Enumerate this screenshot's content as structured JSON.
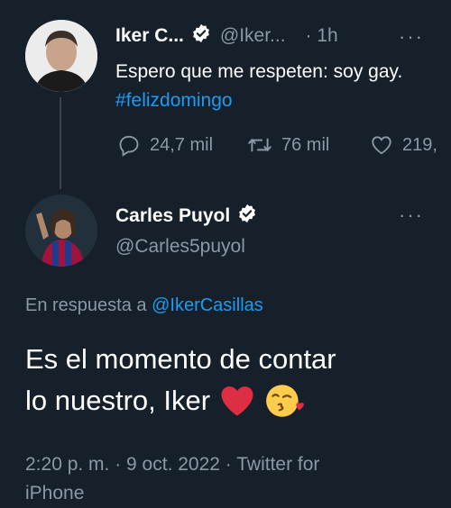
{
  "tweet1": {
    "name": "Iker C...",
    "handle": "@Iker...",
    "time": "· 1h",
    "text": "Espero que me respeten: soy gay. ",
    "hashtag": "#felizdomingo",
    "replies": "24,7 mil",
    "retweets": "76 mil",
    "likes": "219,"
  },
  "tweet2": {
    "name": "Carles Puyol",
    "handle": "@Carles5puyol",
    "reply_prefix": "En respuesta a ",
    "reply_handle": "@IkerCasillas",
    "text_line1": "Es el momento de contar",
    "text_line2": "lo nuestro, Iker",
    "meta_line1": "2:20 p. m. · 9 oct. 2022 · Twitter for",
    "meta_line2": "iPhone"
  },
  "icons": {
    "more": "···"
  },
  "colors": {
    "background": "#15202b",
    "accent": "#1d9bf0",
    "muted": "#8b98a5"
  }
}
